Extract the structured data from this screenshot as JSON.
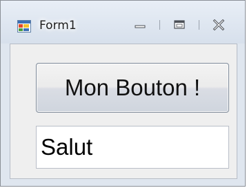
{
  "window": {
    "title": "Form1",
    "controls": {
      "minimize_icon": "minimize-icon",
      "maximize_icon": "maximize-icon",
      "close_icon": "close-icon"
    }
  },
  "form": {
    "button_label": "Mon Bouton !",
    "textbox_value": "Salut"
  },
  "colors": {
    "titlebar": "#d7e0ec",
    "client": "#efefef",
    "button_top": "#f3f3f3",
    "button_bottom": "#cfd5de",
    "textbox": "#ffffff"
  }
}
